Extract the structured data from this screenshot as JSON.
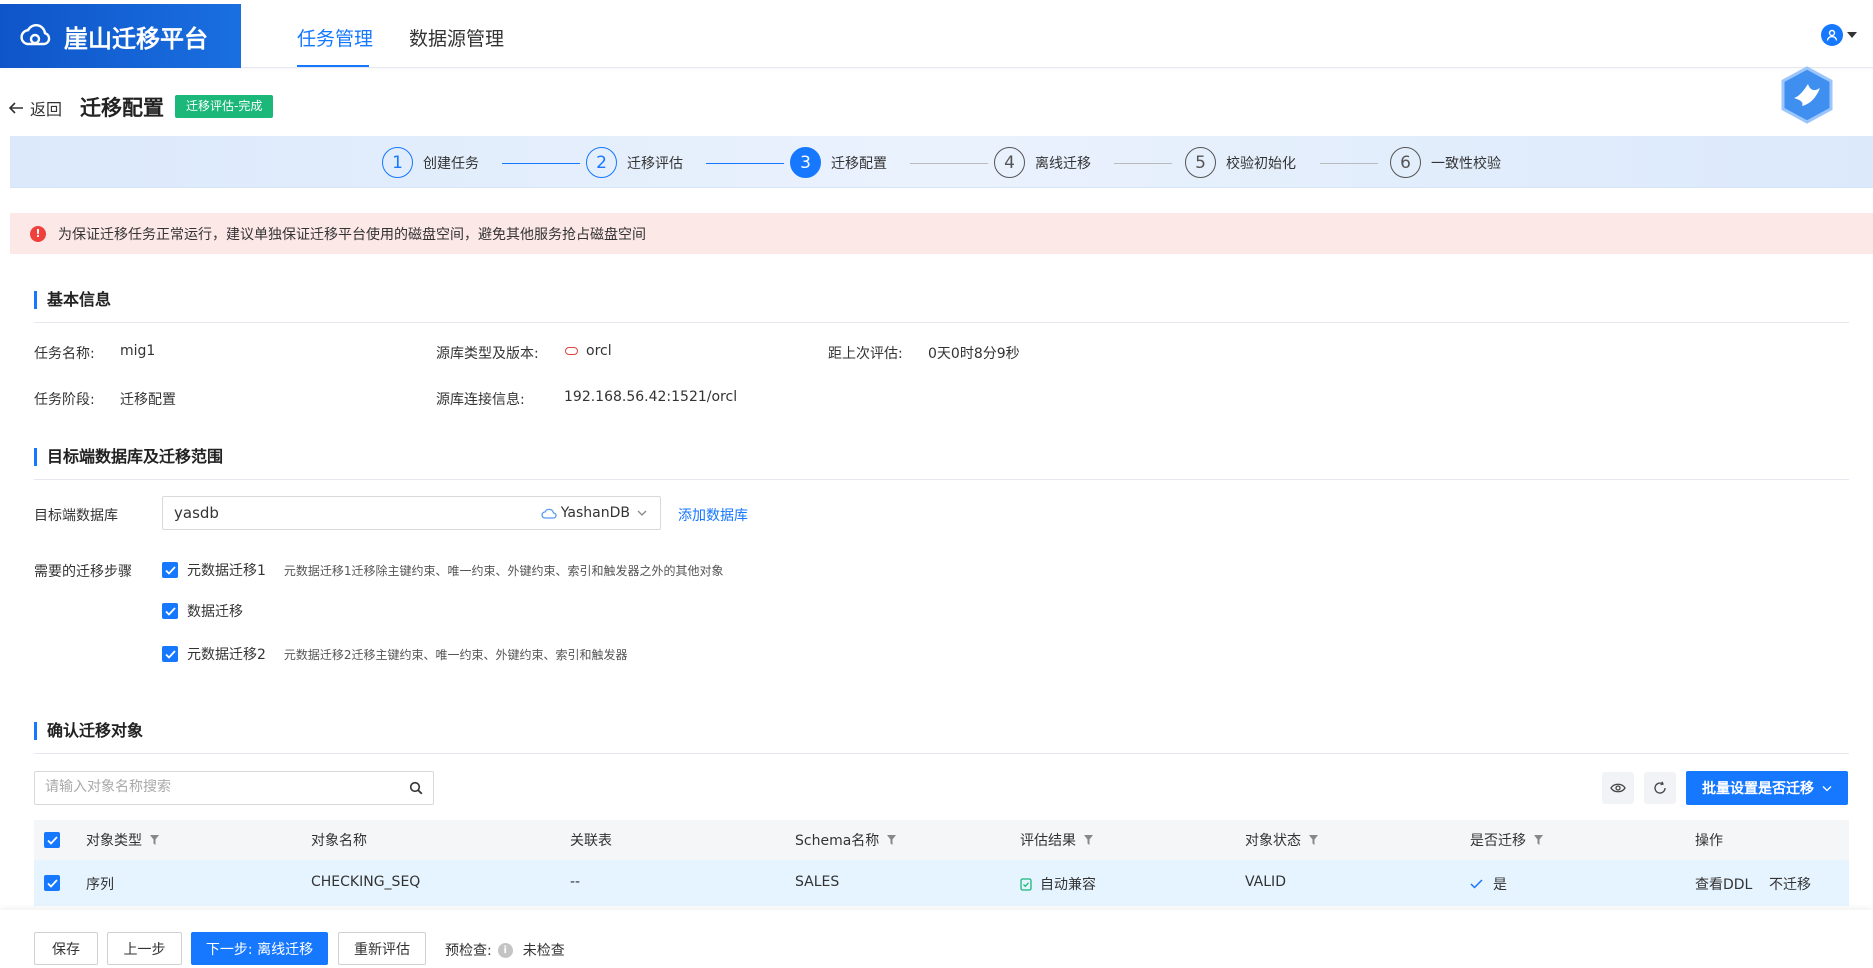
{
  "app": {
    "title": "崖山迁移平台"
  },
  "nav": {
    "tabs": [
      {
        "label": "任务管理",
        "active": true
      },
      {
        "label": "数据源管理",
        "active": false
      }
    ]
  },
  "header": {
    "back_label": "返回",
    "title": "迁移配置",
    "status_badge": "迁移评估-完成"
  },
  "steps": [
    {
      "num": "1",
      "label": "创建任务",
      "state": "done"
    },
    {
      "num": "2",
      "label": "迁移评估",
      "state": "done"
    },
    {
      "num": "3",
      "label": "迁移配置",
      "state": "active"
    },
    {
      "num": "4",
      "label": "离线迁移",
      "state": "todo"
    },
    {
      "num": "5",
      "label": "校验初始化",
      "state": "todo"
    },
    {
      "num": "6",
      "label": "一致性校验",
      "state": "todo"
    }
  ],
  "alert": {
    "text": "为保证迁移任务正常运行，建议单独保证迁移平台使用的磁盘空间，避免其他服务抢占磁盘空间"
  },
  "basic_info": {
    "title": "基本信息",
    "task_name_label": "任务名称:",
    "task_name": "mig1",
    "source_type_label": "源库类型及版本:",
    "source_type": "orcl",
    "last_eval_label": "距上次评估:",
    "last_eval": "0天0时8分9秒",
    "task_stage_label": "任务阶段:",
    "task_stage": "迁移配置",
    "source_conn_label": "源库连接信息:",
    "source_conn": "192.168.56.42:1521/orcl"
  },
  "target": {
    "title": "目标端数据库及迁移范围",
    "db_label": "目标端数据库",
    "db_value": "yasdb",
    "db_type": "YashanDB",
    "add_db_link": "添加数据库",
    "steps_label": "需要的迁移步骤",
    "migration_steps": [
      {
        "label": "元数据迁移1",
        "desc": "元数据迁移1迁移除主键约束、唯一约束、外键约束、索引和触发器之外的其他对象",
        "checked": true
      },
      {
        "label": "数据迁移",
        "desc": "",
        "checked": true
      },
      {
        "label": "元数据迁移2",
        "desc": "元数据迁移2迁移主键约束、唯一约束、外键约束、索引和触发器",
        "checked": true
      }
    ]
  },
  "objects": {
    "title": "确认迁移对象",
    "search_placeholder": "请输入对象名称搜索",
    "batch_button": "批量设置是否迁移",
    "columns": [
      "对象类型",
      "对象名称",
      "关联表",
      "Schema名称",
      "评估结果",
      "对象状态",
      "是否迁移",
      "操作"
    ],
    "rows": [
      {
        "type": "序列",
        "name": "CHECKING_SEQ",
        "related": "--",
        "schema": "SALES",
        "result": "自动兼容",
        "status": "VALID",
        "migrate": "是",
        "action_view": "查看DDL",
        "action_skip": "不迁移"
      }
    ]
  },
  "footer": {
    "save": "保存",
    "prev": "上一步",
    "next": "下一步: 离线迁移",
    "reeval": "重新评估",
    "precheck_label": "预检查:",
    "precheck_status": "未检查"
  },
  "colors": {
    "primary": "#1677ff",
    "success": "#1bb87a",
    "danger": "#f0403c",
    "alert_bg": "#fde8e8"
  }
}
